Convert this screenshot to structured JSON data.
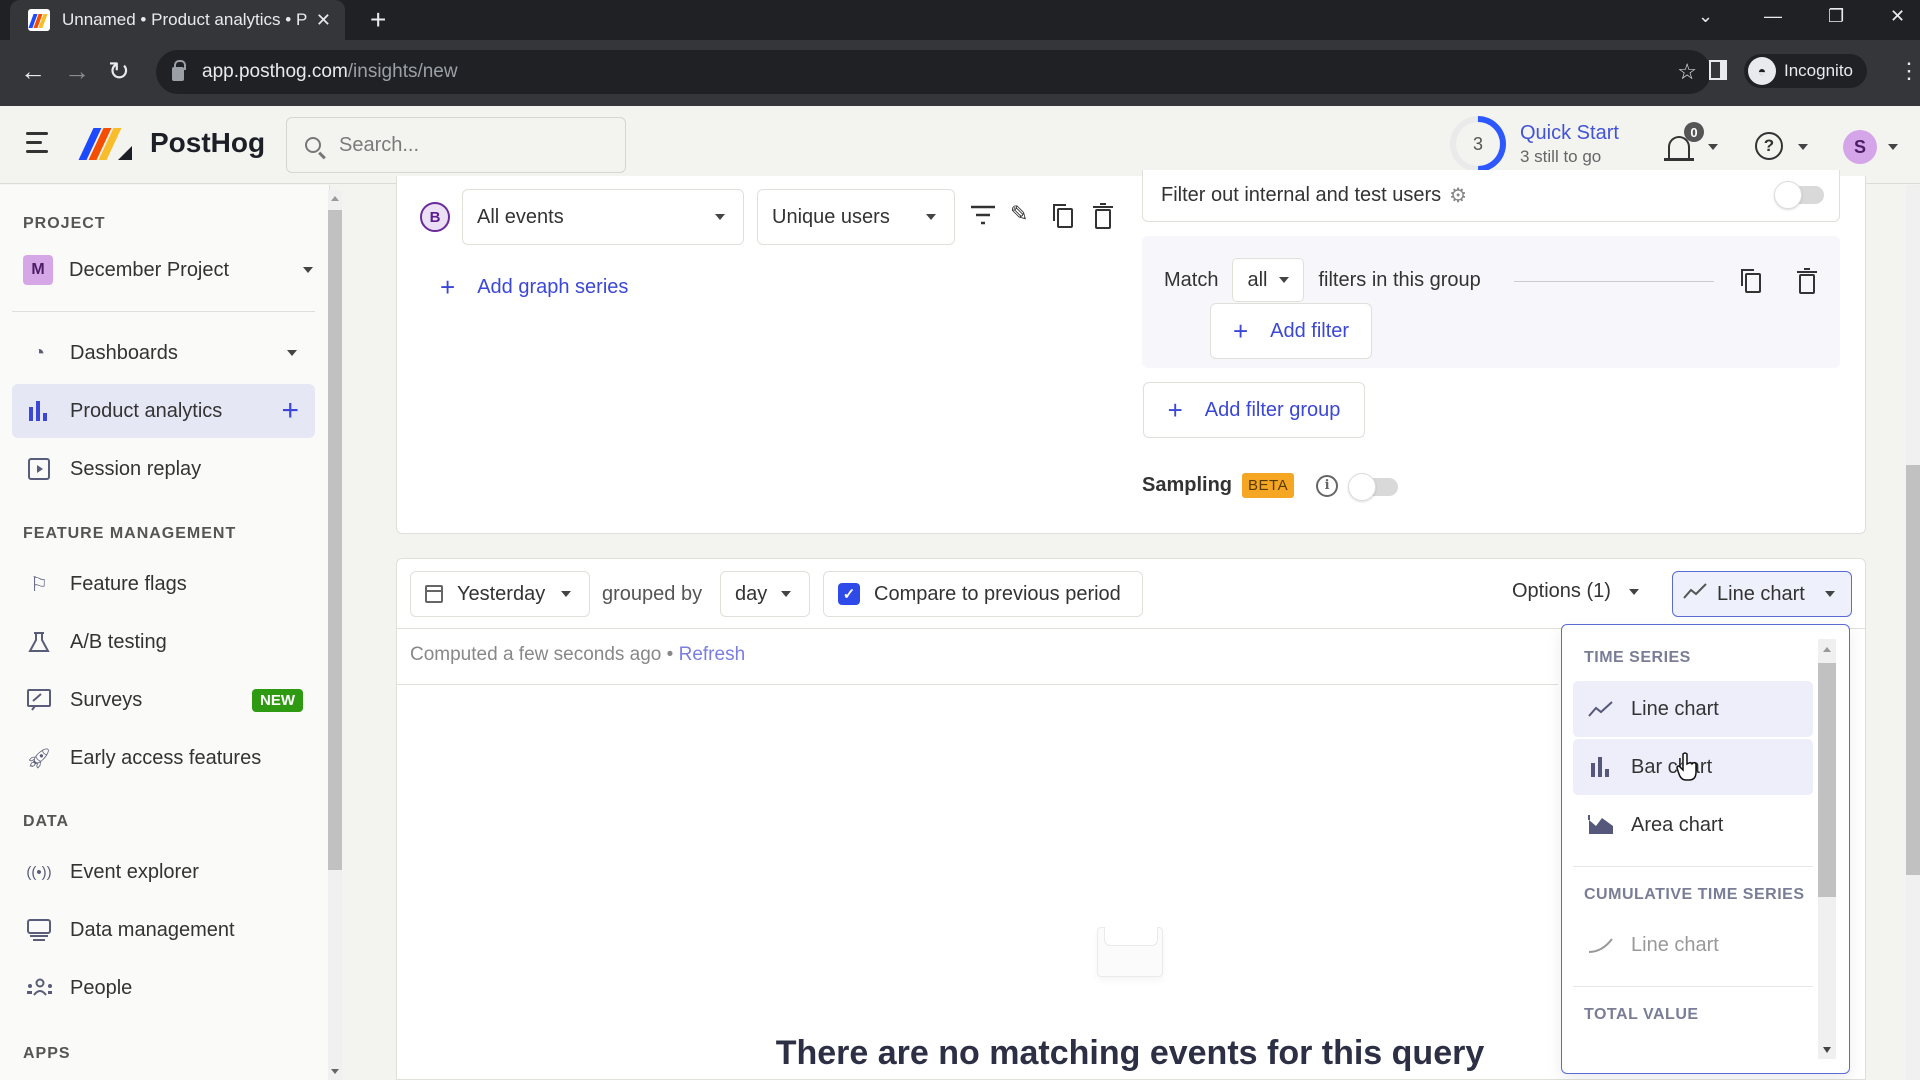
{
  "browser": {
    "tab_title": "Unnamed • Product analytics • PostHog",
    "url_domain": "app.posthog.com",
    "url_path": "/insights/new",
    "profile_label": "Incognito"
  },
  "app": {
    "brand": "PostHog",
    "search_placeholder": "Search...",
    "quick_start": {
      "count": "3",
      "title": "Quick Start",
      "subtitle": "3 still to go"
    },
    "notifications_count": "0",
    "help_glyph": "?",
    "avatar_initial": "S"
  },
  "sidebar": {
    "project_heading": "PROJECT",
    "project": {
      "initial": "M",
      "name": "December Project"
    },
    "items_top": [
      {
        "label": "Dashboards",
        "icon": "gauge-icon"
      },
      {
        "label": "Product analytics",
        "icon": "bar-chart-icon",
        "active": true
      },
      {
        "label": "Session replay",
        "icon": "play-square-icon"
      }
    ],
    "feature_heading": "FEATURE MANAGEMENT",
    "feature_items": [
      {
        "label": "Feature flags",
        "icon": "flag-icon"
      },
      {
        "label": "A/B testing",
        "icon": "flask-icon"
      },
      {
        "label": "Surveys",
        "icon": "survey-icon",
        "badge": "NEW"
      },
      {
        "label": "Early access features",
        "icon": "rocket-icon"
      }
    ],
    "data_heading": "DATA",
    "data_items": [
      {
        "label": "Event explorer",
        "icon": "broadcast-icon"
      },
      {
        "label": "Data management",
        "icon": "monitor-icon"
      },
      {
        "label": "People",
        "icon": "people-icon"
      }
    ],
    "apps_heading": "APPS"
  },
  "series": {
    "letter": "B",
    "event": "All events",
    "aggregation": "Unique users",
    "add_series_label": "Add graph series"
  },
  "filters": {
    "internal_users_label": "Filter out internal and test users",
    "internal_users_enabled": false,
    "match_label": "Match",
    "match_value": "all",
    "group_suffix": "filters in this group",
    "add_filter_label": "Add filter",
    "add_filter_group_label": "Add filter group",
    "sampling_label": "Sampling",
    "sampling_badge": "BETA",
    "sampling_enabled": false
  },
  "query_bar": {
    "date_range": "Yesterday",
    "grouped_by_label": "grouped by",
    "interval": "day",
    "compare_label": "Compare to previous period",
    "compare_checked": true,
    "options_label": "Options (1)",
    "chart_type": "Line chart",
    "computed_text": "Computed a few seconds ago",
    "separator": "•",
    "refresh_label": "Refresh"
  },
  "chart_type_menu": {
    "sections": [
      {
        "heading": "TIME SERIES",
        "items": [
          "Line chart",
          "Bar chart",
          "Area chart"
        ]
      },
      {
        "heading": "CUMULATIVE TIME SERIES",
        "items": [
          "Line chart"
        ]
      },
      {
        "heading": "TOTAL VALUE",
        "items": []
      }
    ]
  },
  "empty_state": {
    "title": "There are no matching events for this query"
  },
  "colors": {
    "accent": "#3b47d6",
    "active_nav_bg": "#e6e7f5",
    "beta_badge": "#f5a623",
    "new_badge": "#2d9a12",
    "checkbox": "#2e4ae8"
  }
}
